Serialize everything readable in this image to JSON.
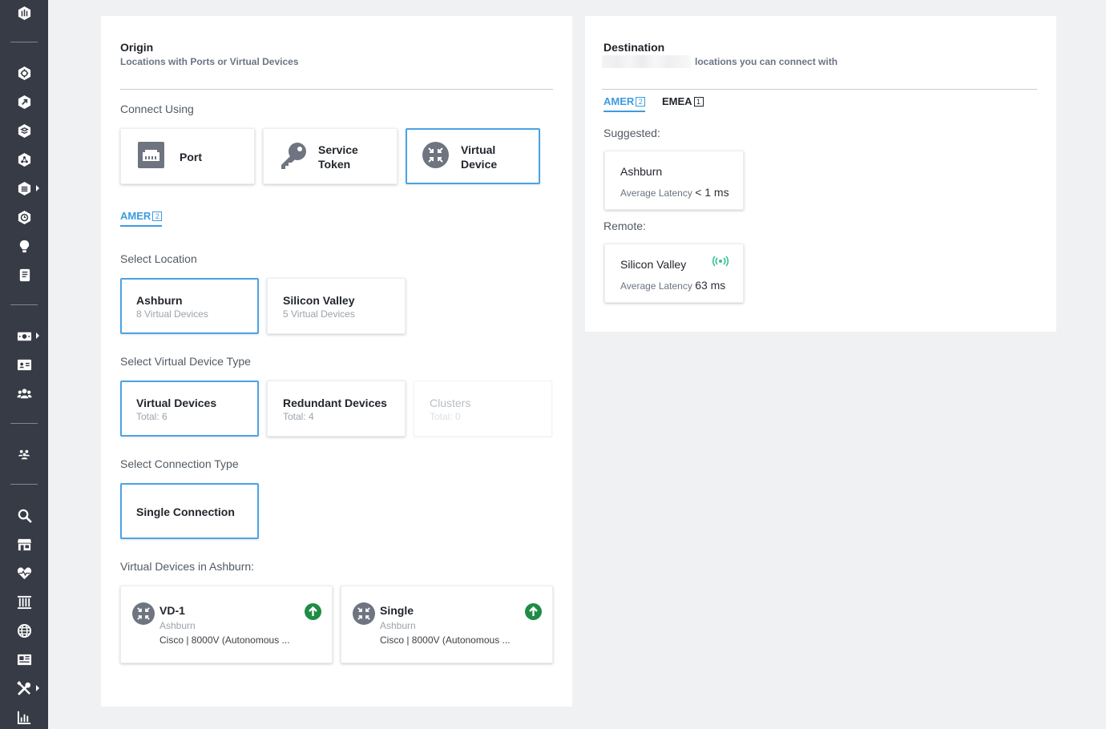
{
  "sidebar": {
    "icons": [
      "logo-icon",
      "hexagon-icon",
      "hexagon-arrow-icon",
      "hexagon-stack-icon",
      "hexagon-network-icon",
      "hexagon-list-icon",
      "clock-icon",
      "lightbulb-icon",
      "document-icon",
      "money-icon",
      "id-card-icon",
      "users-icon",
      "team-icon",
      "search-icon",
      "store-icon",
      "heartbeat-icon",
      "building-icon",
      "globe-icon",
      "news-icon",
      "tools-icon",
      "bar-chart-icon"
    ]
  },
  "origin": {
    "title": "Origin",
    "subtitle": "Locations with Ports or Virtual Devices",
    "connect_using_label": "Connect Using",
    "connect_options": [
      {
        "label_line1": "Port",
        "label_line2": "",
        "icon": "ethernet-port-icon",
        "selected": false
      },
      {
        "label_line1": "Service",
        "label_line2": "Token",
        "icon": "key-icon",
        "selected": false
      },
      {
        "label_line1": "Virtual",
        "label_line2": "Device",
        "icon": "virtual-device-icon",
        "selected": true
      }
    ],
    "region_tab": {
      "label": "AMER",
      "count": "2"
    },
    "select_location_label": "Select Location",
    "locations": [
      {
        "name": "Ashburn",
        "sub": "8 Virtual Devices",
        "selected": true
      },
      {
        "name": "Silicon Valley",
        "sub": "5 Virtual Devices",
        "selected": false
      }
    ],
    "select_device_type_label": "Select Virtual Device Type",
    "device_types": [
      {
        "name": "Virtual Devices",
        "sub": "Total: 6",
        "selected": true,
        "disabled": false
      },
      {
        "name": "Redundant Devices",
        "sub": "Total: 4",
        "selected": false,
        "disabled": false
      },
      {
        "name": "Clusters",
        "sub": "Total: 0",
        "selected": false,
        "disabled": true
      }
    ],
    "select_connection_type_label": "Select Connection Type",
    "connection_type": {
      "name": "Single Connection",
      "selected": true
    },
    "devices_in_label": "Virtual Devices in Ashburn:",
    "devices": [
      {
        "name": "VD-1",
        "location": "Ashburn",
        "model": "Cisco | 8000V (Autonomous ...",
        "status_icon": "status-up-icon"
      },
      {
        "name": "Single",
        "location": "Ashburn",
        "model": "Cisco | 8000V (Autonomous ...",
        "status_icon": "status-up-icon"
      }
    ]
  },
  "destination": {
    "title": "Destination",
    "subtitle": "locations you can connect with",
    "tabs": [
      {
        "label": "AMER",
        "count": "2",
        "active": true
      },
      {
        "label": "EMEA",
        "count": "1",
        "active": false
      }
    ],
    "suggested_label": "Suggested:",
    "suggested": {
      "name": "Ashburn",
      "latency_label": "Average Latency",
      "latency_value": "< 1 ms"
    },
    "remote_label": "Remote:",
    "remote": {
      "name": "Silicon Valley",
      "latency_label": "Average Latency",
      "latency_value": "63 ms",
      "icon": "broadcast-icon"
    }
  },
  "colors": {
    "sidebar_bg": "#363b45",
    "accent": "#3d9be0",
    "status_green": "#1e8c45",
    "signal_green": "#34c38f"
  }
}
